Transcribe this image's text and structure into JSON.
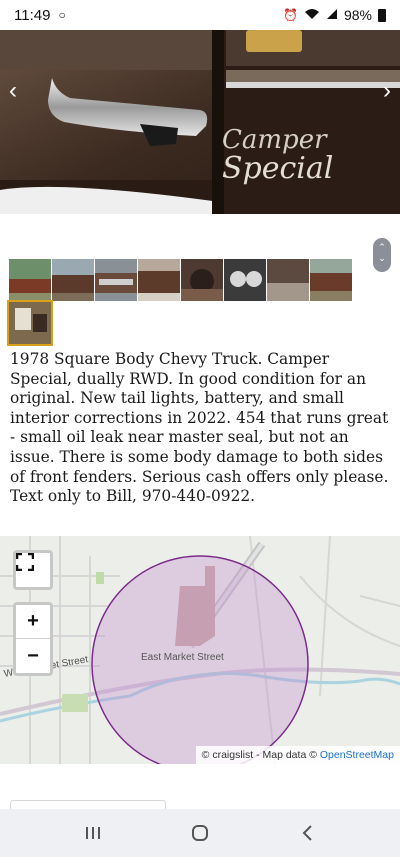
{
  "status_bar": {
    "time": "11:49",
    "battery": "98%",
    "icons": [
      "circle-icon",
      "alarm-icon",
      "wifi-icon",
      "signal-icon",
      "battery-icon"
    ]
  },
  "gallery": {
    "thumbnail_count": 9,
    "selected_index": 8
  },
  "description": "1978 Square Body Chevy Truck. Camper Special, dually RWD. In good condition for an original. New tail lights, battery, and small interior corrections in 2022. 454 that runs great - small oil leak near master seal, but not an issue. There is some body damage to both sides of front fenders. Serious cash offers only please. Text only to Bill, 970-440-0922.",
  "map": {
    "street_label_east": "East Market Street",
    "street_label_west": "West Market Street",
    "attribution_prefix": "© craigslist - Map data ©",
    "attribution_link": "OpenStreetMap",
    "circle_color": "#7b2a8c"
  },
  "nav": [
    "recents-button",
    "home-button",
    "back-button"
  ]
}
